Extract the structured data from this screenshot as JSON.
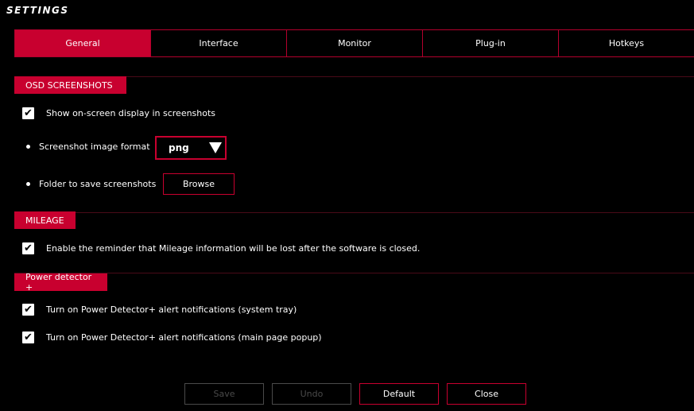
{
  "window": {
    "title": "SETTINGS"
  },
  "tabs": [
    {
      "label": "General",
      "active": true
    },
    {
      "label": "Interface",
      "active": false
    },
    {
      "label": "Monitor",
      "active": false
    },
    {
      "label": "Plug-in",
      "active": false
    },
    {
      "label": "Hotkeys",
      "active": false
    }
  ],
  "osd": {
    "header": "OSD SCREENSHOTS",
    "show_osd": {
      "label": "Show on-screen display in screenshots",
      "checked": true
    },
    "format": {
      "label": "Screenshot image format",
      "value": "png"
    },
    "folder": {
      "label": "Folder to save screenshots",
      "button": "Browse"
    }
  },
  "mileage": {
    "header": "MILEAGE",
    "reminder": {
      "label": "Enable the reminder that Mileage information will be lost after the software is closed.",
      "checked": true
    }
  },
  "power": {
    "header": "Power detector +",
    "tray": {
      "label": "Turn on Power Detector+ alert notifications (system tray)",
      "checked": true
    },
    "popup": {
      "label": "Turn on Power Detector+ alert notifications (main page popup)",
      "checked": true
    }
  },
  "footer": {
    "save": "Save",
    "undo": "Undo",
    "default": "Default",
    "close": "Close"
  },
  "colors": {
    "accent": "#c8002f",
    "background": "#000000",
    "disabled": "#4a4a4a"
  }
}
